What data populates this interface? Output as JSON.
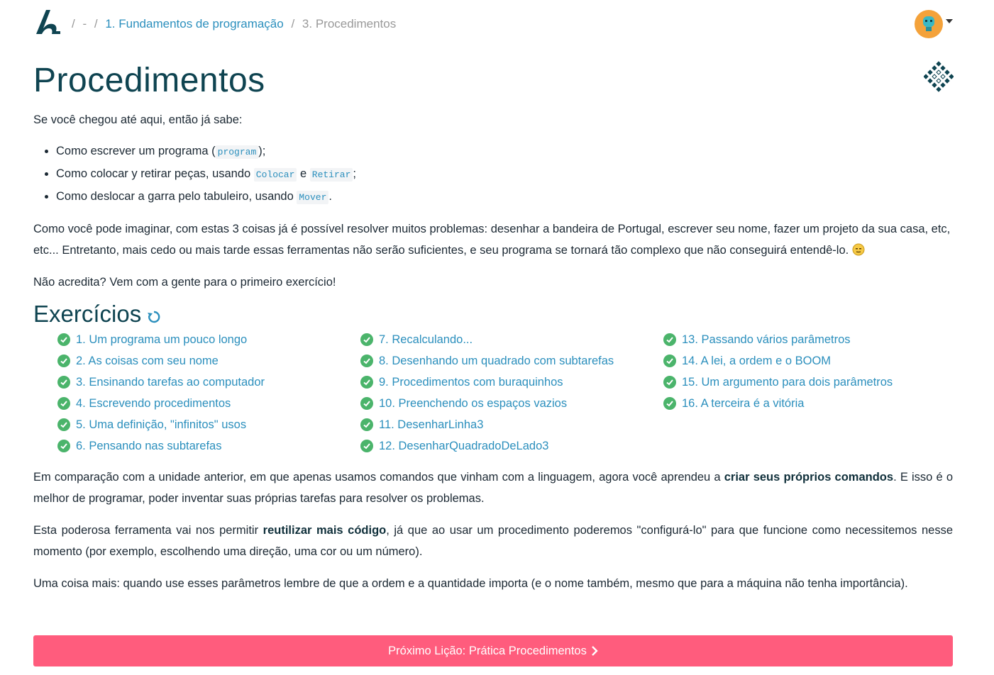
{
  "breadcrumb": {
    "sep1": "/",
    "dash": "-",
    "sep2": "/",
    "chapter": "1. Fundamentos de programação",
    "sep3": "/",
    "lesson": "3. Procedimentos"
  },
  "icons": {
    "logo": "mumuki-logo-icon",
    "avatar": "user-avatar-icon",
    "gobstones": "gobstones-diamond-icon",
    "reload": "reload-icon",
    "check": "check-circle-icon",
    "chevron": "chevron-right-icon"
  },
  "colors": {
    "title": "#0f4451",
    "link": "#2b8fbd",
    "check": "#4bb46b",
    "next_button": "#ff5c7d",
    "avatar_bg": "#f4a23a"
  },
  "page": {
    "title": "Procedimentos",
    "intro": "Se você chegou até aqui, então já sabe:",
    "knows": [
      {
        "before": "Como escrever um programa (",
        "code": "program",
        "after": ");"
      },
      {
        "before": "Como colocar y retirar peças, usando ",
        "code": "Colocar",
        "mid": " e ",
        "code2": "Retirar",
        "after": ";"
      },
      {
        "before": "Como deslocar a garra pelo tabuleiro, usando ",
        "code": "Mover",
        "after": "."
      }
    ],
    "para1": "Como você pode imaginar, com estas 3 coisas já é possível resolver muitos problemas: desenhar a bandeira de Portugal, escrever seu nome, fazer um projeto da sua casa, etc, etc... Entretanto, mais cedo ou mais tarde essas ferramentas não serão suficientes, e seu programa se tornará tão complexo que não conseguirá entendê-lo.",
    "para2": "Não acredita? Vem com a gente para o primeiro exercício!",
    "exercises_title": "Exercícios",
    "exercises": [
      [
        "1. Um programa um pouco longo",
        "2. As coisas com seu nome",
        "3. Ensinando tarefas ao computador",
        "4. Escrevendo procedimentos",
        "5. Uma definição, \"infinitos\" usos",
        "6. Pensando nas subtarefas"
      ],
      [
        "7. Recalculando...",
        "8. Desenhando um quadrado com subtarefas",
        "9. Procedimentos com buraquinhos",
        "10. Preenchendo os espaços vazios",
        "11. DesenharLinha3",
        "12. DesenharQuadradoDeLado3"
      ],
      [
        "13. Passando vários parâmetros",
        "14. A lei, a ordem e o BOOM",
        "15. Um argumento para dois parâmetros",
        "16. A terceira é a vitória"
      ]
    ],
    "para3_before": "Em comparação com a unidade anterior, em que apenas usamos comandos que vinham com a linguagem, agora você aprendeu a ",
    "para3_strong": "criar seus próprios comandos",
    "para3_after": ". E isso é o melhor de programar, poder inventar suas próprias tarefas para resolver os problemas.",
    "para4_before": "Esta poderosa ferramenta vai nos permitir ",
    "para4_strong": "reutilizar mais código",
    "para4_after": ", já que ao usar um procedimento poderemos \"configurá-lo\" para que funcione como necessitemos nesse momento (por exemplo, escolhendo uma direção, uma cor ou um número).",
    "para5": "Uma coisa mais: quando use esses parâmetros lembre de que a ordem e a quantidade importa (e o nome também, mesmo que para a máquina não tenha importância).",
    "next_button": "Próximo Lição: Prática Procedimentos"
  }
}
